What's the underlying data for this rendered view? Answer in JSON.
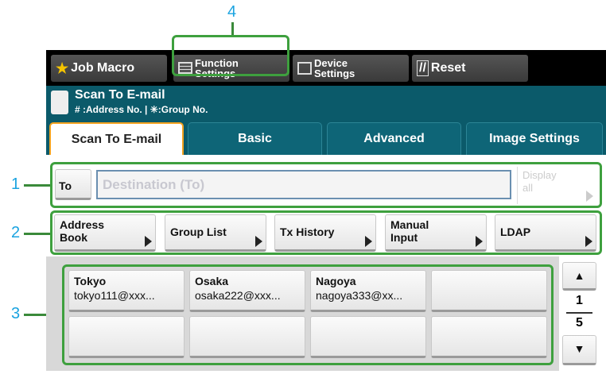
{
  "callouts": [
    "1",
    "2",
    "3",
    "4"
  ],
  "toolbar": {
    "job_macro": "Job Macro",
    "function_settings": [
      "Function",
      "Settings"
    ],
    "device_settings": [
      "Device",
      "Settings"
    ],
    "reset": "Reset"
  },
  "header": {
    "title": "Scan To E-mail",
    "subtitle": "# :Address No. | ✳:Group No."
  },
  "tabs": [
    "Scan To E-mail",
    "Basic",
    "Advanced",
    "Image Settings"
  ],
  "destination": {
    "to_label": "To",
    "placeholder": "Destination (To)",
    "display_all": [
      "Display",
      "all"
    ]
  },
  "sources": [
    [
      "Address",
      "Book"
    ],
    [
      "Group List"
    ],
    [
      "Tx History"
    ],
    [
      "Manual",
      "Input"
    ],
    [
      "LDAP"
    ]
  ],
  "addresses": [
    {
      "name": "Tokyo",
      "email": "tokyo111@xxx..."
    },
    {
      "name": "Osaka",
      "email": "osaka222@xxx..."
    },
    {
      "name": "Nagoya",
      "email": "nagoya333@xx..."
    },
    {
      "name": "",
      "email": ""
    },
    {
      "name": "",
      "email": ""
    },
    {
      "name": "",
      "email": ""
    },
    {
      "name": "",
      "email": ""
    },
    {
      "name": "",
      "email": ""
    }
  ],
  "pager": {
    "current": "1",
    "total": "5"
  },
  "colors": {
    "teal": "#0b5a6a",
    "callout": "#1aa3e0",
    "highlight": "#3ea03e",
    "active_tab": "#f3a21f"
  }
}
